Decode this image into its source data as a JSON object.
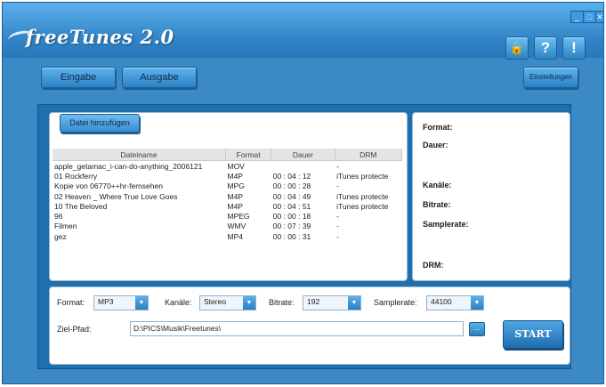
{
  "app": {
    "title": "freeTunes 2.0"
  },
  "window_controls": {
    "minimize": "_",
    "maximize": "□",
    "close": "✕"
  },
  "header_icons": [
    {
      "icon": "lock-icon",
      "glyph": "🔒"
    },
    {
      "icon": "help-icon",
      "glyph": "?"
    },
    {
      "icon": "info-icon",
      "glyph": "!"
    }
  ],
  "tabs": {
    "input": "Eingabe",
    "output": "Ausgabe"
  },
  "settings_button": "Einstellungen",
  "add_file_button": "Datei hinzufügen",
  "table": {
    "columns": [
      "Dateiname",
      "Format",
      "Dauer",
      "DRM"
    ],
    "rows": [
      [
        "apple_getamac_i-can-do-anything_2006121",
        "MOV",
        "",
        "-"
      ],
      [
        "01 Rockferry",
        "M4P",
        "00 : 04 : 12",
        "iTunes protecte"
      ],
      [
        "Kopie von 06770++hr-fernsehen",
        "MPG",
        "00 : 00 : 28",
        "-"
      ],
      [
        "02 Heaven _ Where True Love Goes",
        "M4P",
        "00 : 04 : 49",
        "iTunes protecte"
      ],
      [
        "10 The Beloved",
        "M4P",
        "00 : 04 : 51",
        "iTunes protecte"
      ],
      [
        "96",
        "MPEG",
        "00 : 00 : 18",
        "-"
      ],
      [
        "Filmen",
        "WMV",
        "00 : 07 : 39",
        "-"
      ],
      [
        "gez",
        "MP4",
        "00 : 00 : 31",
        "-"
      ]
    ]
  },
  "info": {
    "format": "Format:",
    "duration": "Dauer:",
    "channels": "Kanäle:",
    "bitrate": "Bitrate:",
    "samplerate": "Samplerate:",
    "drm": "DRM:"
  },
  "options": {
    "format_label": "Format:",
    "format_value": "MP3",
    "channels_label": "Kanäle:",
    "channels_value": "Stereo",
    "bitrate_label": "Bitrate:",
    "bitrate_value": "192",
    "samplerate_label": "Samplerate:",
    "samplerate_value": "44100",
    "path_label": "Ziel-Pfad:",
    "path_value": "D:\\PICS\\Musik\\Freetunes\\",
    "browse": "..."
  },
  "start_button": "START"
}
